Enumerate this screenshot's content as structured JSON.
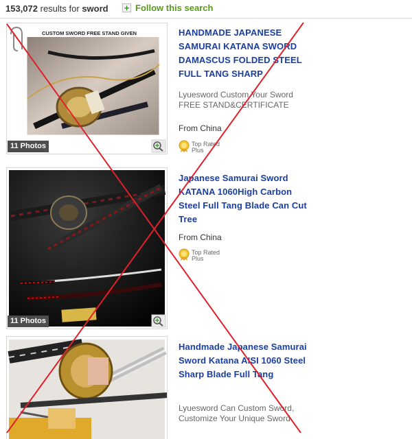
{
  "header": {
    "result_count": "153,072",
    "results_for_text": "results for",
    "query": "sword",
    "follow_label": "Follow this search"
  },
  "listings": [
    {
      "title": "HANDMADE JAPANESE SAMURAI KATANA SWORD DAMASCUS FOLDED STEEL FULL TANG SHARP",
      "banner": "CUSTOM SWORD   FREE STAND GIVEN",
      "photos": "11 Photos",
      "seller_note": "Lyuesword Custom Your Sword FREE STAND&CERTIFICATE",
      "origin": "From China",
      "badge_line1": "Top Rated",
      "badge_line2": "Plus"
    },
    {
      "title": "Japanese Samurai Sword KATANA 1060High Carbon Steel Full Tang Blade Can Cut Tree",
      "photos": "11 Photos",
      "origin": "From China",
      "badge_line1": "Top Rated",
      "badge_line2": "Plus"
    },
    {
      "title": "Handmade Japanese Samurai Sword Katana AISI 1060 Steel Sharp Blade Full Tang",
      "seller_note": "Lyuesword Can Custom Sword, Customize Your Unique Sword"
    }
  ],
  "colors": {
    "title_link": "#1a3fa3",
    "follow_green": "#5a9a1a",
    "overlay_x": "#e0202a"
  },
  "icons": [
    "plus-icon",
    "zoom-icon",
    "paperclip-icon",
    "top-rated-seal-icon"
  ]
}
